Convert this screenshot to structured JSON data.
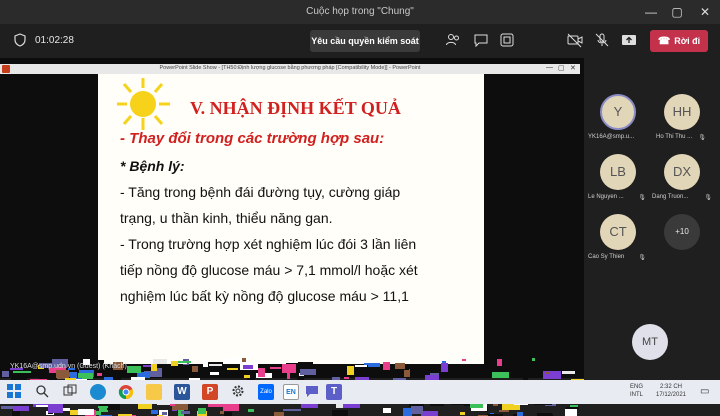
{
  "window": {
    "title": "Cuộc họp trong \"Chung\"",
    "minimize": "—",
    "maximize": "▢",
    "close": "✕"
  },
  "toolbar": {
    "timer": "01:02:28",
    "request_control": "Yêu cầu quyền kiểm soát",
    "leave": "Rời đi",
    "icons": [
      "people-icon",
      "chat-icon",
      "reactions-icon",
      "camera-off-icon",
      "mic-off-icon",
      "share-icon"
    ]
  },
  "powerpoint": {
    "window_title": "PowerPoint Slide Show - [TH50:Định lượng glucose bằng phương pháp [Compatibility Mode]] - PowerPoint",
    "minimize": "—",
    "maximize": "▢",
    "close": "✕"
  },
  "slide": {
    "title": "V. NHẬN ĐỊNH KẾT QUẢ",
    "subtitle": "- Thay đổi trong các trường hợp sau:",
    "lines": [
      "* Bệnh lý:",
      "- Tăng trong bệnh đái đường tụy, cường giáp",
      "trạng, u thần kinh, thiểu năng gan.",
      "- Trong trường hợp xét nghiệm lúc đói 3 lần liên",
      "tiếp nồng độ glucose máu > 7,1 mmol/l hoặc xét",
      "nghiệm lúc bất kỳ nồng độ glucose máu > 11,1"
    ]
  },
  "presenter_label": "YK16A@smp.udn.vn (Guest) (Khách)",
  "participants": [
    {
      "initials": "Y",
      "name": "YK16A@smp.u...",
      "active": true
    },
    {
      "initials": "HH",
      "name": "Ho Thi Thu ..."
    },
    {
      "initials": "LB",
      "name": "Le Nguyen ..."
    },
    {
      "initials": "DX",
      "name": "Dang Truon..."
    },
    {
      "initials": "CT",
      "name": "Cao Sy Thien"
    },
    {
      "initials": "+10",
      "name": ""
    }
  ],
  "self_avatar": "MT",
  "taskbar": {
    "lang_top": "ENG",
    "lang_bottom": "INTL",
    "time": "2:32 CH",
    "date": "17/12/2021",
    "icons": [
      "windows-start-icon",
      "search-icon",
      "task-view-icon",
      "edge-icon",
      "chrome-icon",
      "file-explorer-icon",
      "word-icon",
      "powerpoint-icon",
      "settings-icon",
      "zalo-icon",
      "unikey-icon",
      "chat-icon",
      "teams-icon"
    ]
  },
  "colors": {
    "leave_button": "#c4314b",
    "slide_title": "#d12020",
    "active_ring": "#8b8cc7"
  }
}
